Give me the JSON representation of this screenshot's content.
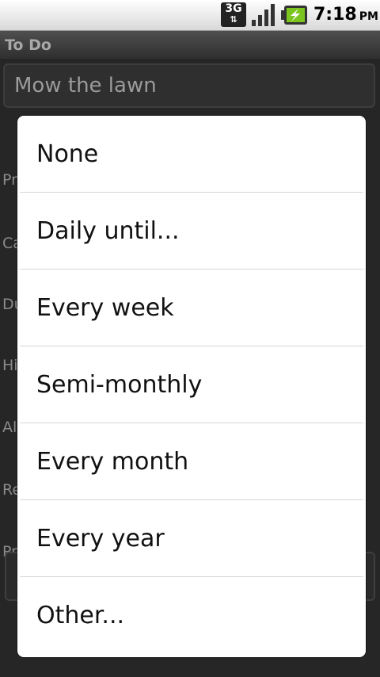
{
  "status_bar": {
    "network": "3G",
    "time": "7:18",
    "ampm": "PM",
    "icons": [
      "3g-data-icon",
      "signal-strength-icon",
      "battery-charging-icon"
    ]
  },
  "app": {
    "title": "To Do",
    "task_name": "Mow the lawn",
    "background_labels": [
      "Pr",
      "Ca",
      "Du",
      "Hi",
      "Al",
      "Re",
      "Pr"
    ]
  },
  "dialog": {
    "options": [
      "None",
      "Daily until...",
      "Every week",
      "Semi-monthly",
      "Every month",
      "Every year",
      "Other..."
    ]
  }
}
